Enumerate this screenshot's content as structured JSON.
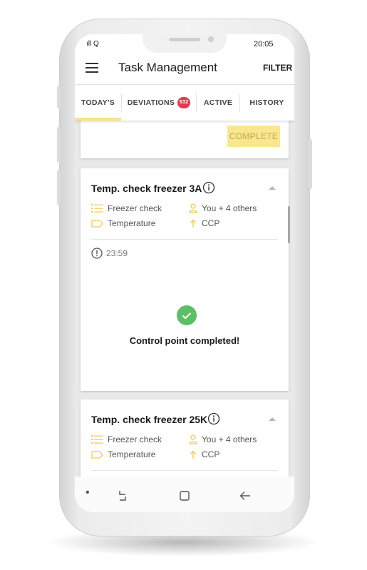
{
  "status_bar": {
    "signal": "ıll Q",
    "time": "20:05"
  },
  "app_bar": {
    "menu_icon": "hamburger-menu-icon",
    "title": "Task Management",
    "filter_label": "FILTER"
  },
  "tabs": [
    {
      "label": "TODAY'S",
      "active": true
    },
    {
      "label": "DEVIATIONS",
      "badge": "532",
      "active": false
    },
    {
      "label": "ACTIVE",
      "active": false
    },
    {
      "label": "HISTORY",
      "active": false
    }
  ],
  "top_card": {
    "complete_label": "COMPLETE"
  },
  "cards": [
    {
      "title": "Temp. check freezer 3A",
      "checklist": "Freezer check",
      "type": "Temperature",
      "assignee": "You + 4 others",
      "category": "CCP",
      "deadline": "23:59",
      "status_message": "Control point completed!"
    },
    {
      "title": "Temp. check freezer 25K",
      "checklist": "Freezer check",
      "type": "Temperature",
      "assignee": "You + 4 others",
      "category": "CCP"
    }
  ],
  "colors": {
    "accent_yellow": "#f7e388",
    "badge_red": "#e53950",
    "success_green": "#5cbf66",
    "icon_yellow": "#f2c94c"
  },
  "nav_bar": {
    "dot": "•",
    "recents_icon": "recents-icon",
    "home_icon": "home-square-icon",
    "back_icon": "back-arrow-icon"
  }
}
